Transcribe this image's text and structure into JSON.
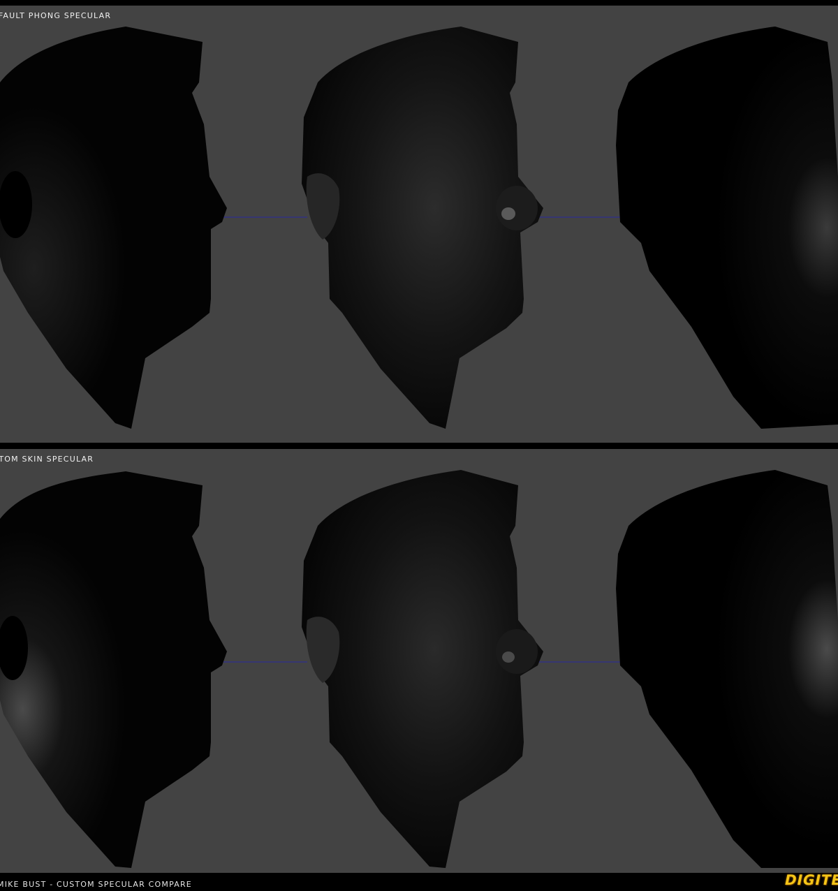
{
  "panels": [
    {
      "label": "Default Phong Specular"
    },
    {
      "label": "Custom Skin Specular"
    }
  ],
  "footer": {
    "title": "Mike Bust - Custom Specular Compare"
  },
  "logo": {
    "text": "DIGITEC"
  },
  "colors": {
    "viewport_bg": "#434343",
    "frame_bg": "#000000",
    "guide_line": "#2a2aa0",
    "label_text": "#f2f2f2",
    "logo_yellow": "#f5c518"
  }
}
